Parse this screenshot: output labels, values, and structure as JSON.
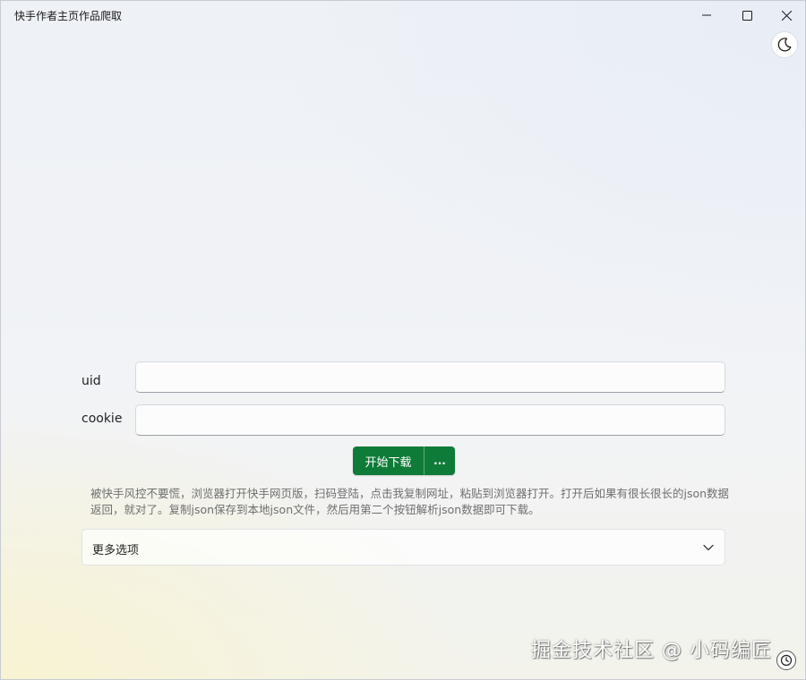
{
  "window": {
    "title": "快手作者主页作品爬取"
  },
  "title_bar_icons": {
    "minimize": "minimize-icon",
    "maximize": "maximize-icon",
    "close": "close-icon"
  },
  "theme_toggle": {
    "icon": "moon-icon"
  },
  "form": {
    "uid_label": "uid",
    "uid_value": "",
    "cookie_label": "cookie",
    "cookie_value": ""
  },
  "actions": {
    "download_label": "开始下载",
    "more_label": "...",
    "accent_color": "#0f7b38"
  },
  "hint": "被快手风控不要慌，浏览器打开快手网页版，扫码登陆，点击我复制网址，粘贴到浏览器打开。打开后如果有很长很长的json数据返回，就对了。复制json保存到本地json文件，然后用第二个按钮解析json数据即可下载。",
  "expander": {
    "label": "更多选项",
    "icon": "chevron-down-icon"
  },
  "watermark": "掘金技术社区 @ 小码编匠",
  "help": {
    "icon": "history-icon"
  }
}
